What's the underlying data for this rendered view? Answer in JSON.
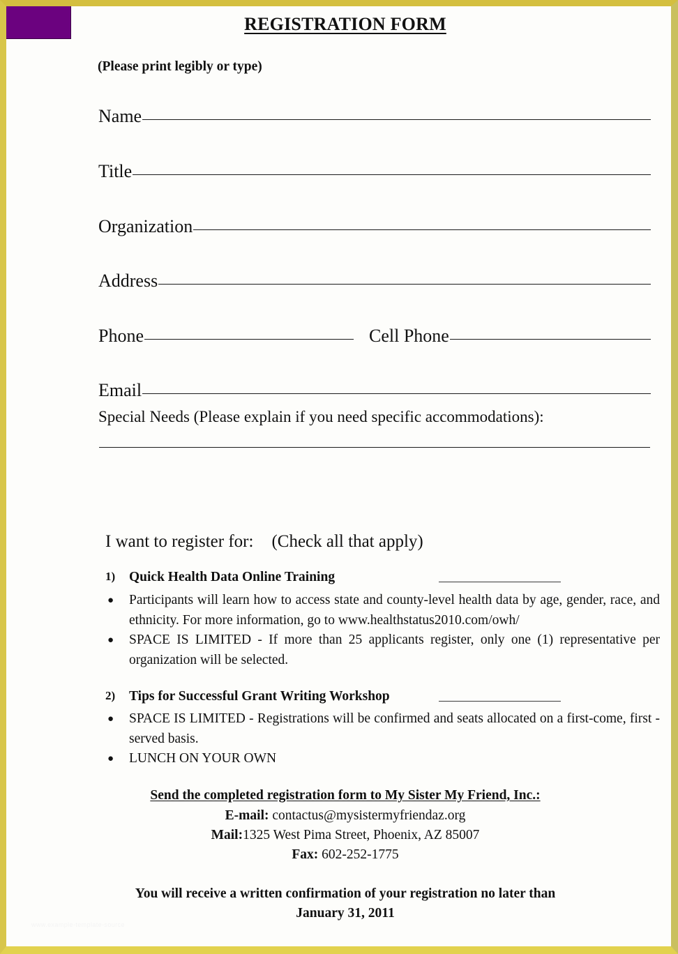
{
  "document": {
    "title": "REGISTRATION FORM",
    "print_note": "(Please print legibly or type)",
    "accent_purple": "#6b027f",
    "border_color": "#d4bf3f",
    "page_background": "#fdfdfb",
    "watermark": "www.example-template-source"
  },
  "fields": [
    {
      "label": "Name",
      "value": "",
      "rule": "long"
    },
    {
      "label": "Title",
      "value": "",
      "rule": "long"
    },
    {
      "label": "Organization",
      "value": "",
      "rule": "long"
    },
    {
      "label": "Address",
      "value": "",
      "rule": "long"
    },
    {
      "label": "Phone",
      "value": "",
      "rule": "short"
    },
    {
      "label": "Cell Phone",
      "value": "",
      "rule": "long"
    },
    {
      "label": "Email",
      "value": "",
      "rule": "long"
    }
  ],
  "special_needs": {
    "label": "Special Needs (Please explain if you need specific accommodations):",
    "value": ""
  },
  "register": {
    "heading": "I want to register for:",
    "instruction": "(Check all that apply)",
    "items": [
      {
        "number": "1)",
        "title": "Quick Health Data Online Training",
        "blank_value": "",
        "bullets": [
          "Participants will learn how to access state and county-level health data by age, gender, race, and ethnicity.  For more information, go to www.healthstatus2010.com/owh/",
          "SPACE IS LIMITED - If more than 25 applicants register, only one (1) representative per organization will be selected."
        ]
      },
      {
        "number": "2)",
        "title": "Tips for Successful Grant Writing Workshop",
        "blank_value": "",
        "bullets": [
          "SPACE IS LIMITED - Registrations will be confirmed and seats  allocated on a first-come, first -served basis.",
          "LUNCH ON YOUR OWN"
        ]
      }
    ]
  },
  "contact": {
    "heading": "Send the completed registration form to My Sister My Friend, Inc.:",
    "email_label": "E-mail:",
    "email_value": "contactus@mysistermyfriendaz.org",
    "mail_label": "Mail:",
    "mail_value": "1325 West Pima Street, Phoenix, AZ 85007",
    "fax_label": "Fax:",
    "fax_value": "602-252-1775"
  },
  "confirmation": {
    "line1": "You will receive a written confirmation of your registration no later than",
    "line2": "January 31, 2011"
  }
}
